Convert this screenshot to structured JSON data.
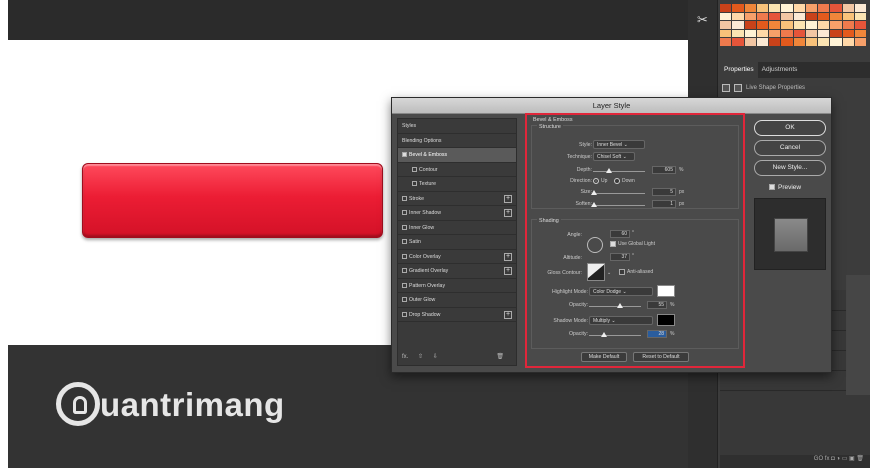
{
  "watermark": {
    "text": "uantrimang"
  },
  "panels": {
    "tab_properties": "Properties",
    "tab_adjustments": "Adjustments",
    "properties_label": "Live Shape Properties",
    "layers_footer": "GO fx ◘ ◑ ▭ ▣ 🗑"
  },
  "dialog": {
    "title": "Layer Style",
    "footer_fx": "fx."
  },
  "sidebar_items": [
    {
      "label": "Styles",
      "checkbox": false,
      "checked": false,
      "selected": false,
      "indent": false,
      "plus": false
    },
    {
      "label": "Blending Options",
      "checkbox": false,
      "checked": false,
      "selected": false,
      "indent": false,
      "plus": false
    },
    {
      "label": "Bevel & Emboss",
      "checkbox": true,
      "checked": true,
      "selected": true,
      "indent": false,
      "plus": false
    },
    {
      "label": "Contour",
      "checkbox": true,
      "checked": false,
      "selected": false,
      "indent": true,
      "plus": false
    },
    {
      "label": "Texture",
      "checkbox": true,
      "checked": false,
      "selected": false,
      "indent": true,
      "plus": false
    },
    {
      "label": "Stroke",
      "checkbox": true,
      "checked": false,
      "selected": false,
      "indent": false,
      "plus": true
    },
    {
      "label": "Inner Shadow",
      "checkbox": true,
      "checked": false,
      "selected": false,
      "indent": false,
      "plus": true
    },
    {
      "label": "Inner Glow",
      "checkbox": true,
      "checked": false,
      "selected": false,
      "indent": false,
      "plus": false
    },
    {
      "label": "Satin",
      "checkbox": true,
      "checked": false,
      "selected": false,
      "indent": false,
      "plus": false
    },
    {
      "label": "Color Overlay",
      "checkbox": true,
      "checked": false,
      "selected": false,
      "indent": false,
      "plus": true
    },
    {
      "label": "Gradient Overlay",
      "checkbox": true,
      "checked": false,
      "selected": false,
      "indent": false,
      "plus": true
    },
    {
      "label": "Pattern Overlay",
      "checkbox": true,
      "checked": false,
      "selected": false,
      "indent": false,
      "plus": false
    },
    {
      "label": "Outer Glow",
      "checkbox": true,
      "checked": false,
      "selected": false,
      "indent": false,
      "plus": false
    },
    {
      "label": "Drop Shadow",
      "checkbox": true,
      "checked": false,
      "selected": false,
      "indent": false,
      "plus": true
    }
  ],
  "bevel": {
    "heading": "Bevel & Emboss",
    "structure_heading": "Structure",
    "style_label": "Style:",
    "style_value": "Inner Bevel  ⌄",
    "technique_label": "Technique:",
    "technique_value": "Chisel Soft ⌄",
    "depth_label": "Depth:",
    "depth_value": "605",
    "direction_label": "Direction:",
    "direction_up": "Up",
    "direction_down": "Down",
    "size_label": "Size:",
    "size_value": "5",
    "soften_label": "Soften:",
    "soften_value": "1"
  },
  "shading": {
    "heading": "Shading",
    "angle_label": "Angle:",
    "angle_value": "60",
    "global_light": "Use Global Light",
    "altitude_label": "Altitude:",
    "altitude_value": "37",
    "gloss_label": "Gloss Contour:",
    "anti_aliased": "Anti-aliased",
    "highlight_label": "Highlight Mode:",
    "highlight_value": "Color Dodge  ⌄",
    "opacity_label": "Opacity:",
    "highlight_opacity": "55",
    "shadow_label": "Shadow Mode:",
    "shadow_value": "Multiply  ⌄",
    "shadow_opacity": "28"
  },
  "units": {
    "percent": "%",
    "px": "px",
    "degree": "°"
  },
  "buttons": {
    "make_default": "Make Default",
    "reset_default": "Reset to Default",
    "ok": "OK",
    "cancel": "Cancel",
    "new_style": "New Style...",
    "preview": "Preview"
  },
  "colors": {
    "button_red": "#ec1d34",
    "highlight_color": "#ffffff",
    "shadow_color": "#000000",
    "annotation_red": "#e0263a"
  },
  "swatch_colors": [
    "#c9421a",
    "#e35a1d",
    "#f0863a",
    "#f8c27a",
    "#fbe4b2",
    "#fff3d6",
    "#ffd8a8",
    "#f7a06a",
    "#ef7a4d",
    "#e6553a",
    "#f2c6a3",
    "#fbe9d4"
  ]
}
